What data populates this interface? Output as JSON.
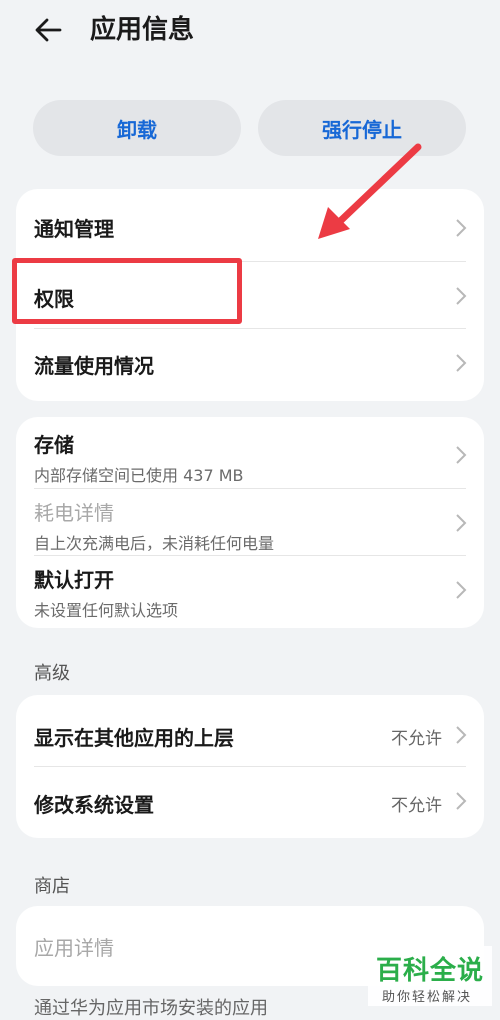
{
  "header": {
    "title": "应用信息",
    "back_icon": "back-arrow-icon"
  },
  "actions": {
    "uninstall_label": "卸载",
    "force_stop_label": "强行停止",
    "accent": "#1768d6"
  },
  "group1": [
    {
      "title": "通知管理"
    },
    {
      "title": "权限"
    },
    {
      "title": "流量使用情况"
    }
  ],
  "group2": [
    {
      "title": "存储",
      "subtitle": "内部存储空间已使用 437 MB"
    },
    {
      "title": "耗电详情",
      "subtitle": "自上次充满电后，未消耗任何电量",
      "disabled": true
    },
    {
      "title": "默认打开",
      "subtitle": "未设置任何默认选项"
    }
  ],
  "advanced": {
    "label": "高级",
    "items": [
      {
        "title": "显示在其他应用的上层",
        "value": "不允许"
      },
      {
        "title": "修改系统设置",
        "value": "不允许"
      }
    ]
  },
  "store": {
    "label": "商店",
    "items": [
      {
        "title": "应用详情",
        "disabled": true
      }
    ],
    "footer": "通过华为应用市场安装的应用"
  },
  "annotation": {
    "highlight_color": "#ec3b44"
  },
  "watermark": {
    "logo": "百科全说",
    "tagline": "助你轻松解决"
  }
}
